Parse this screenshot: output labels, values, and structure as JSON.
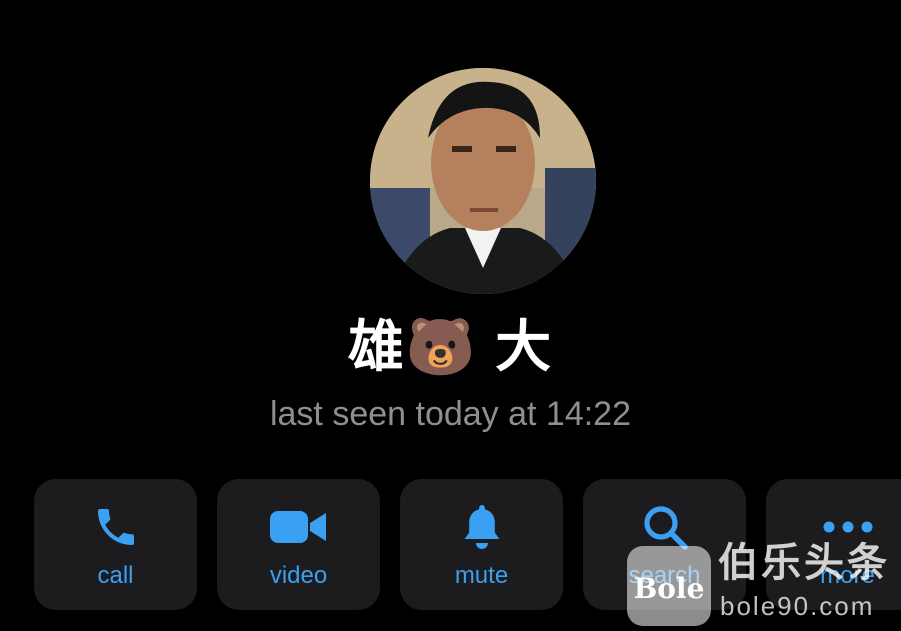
{
  "profile": {
    "name": "雄🐻 大",
    "status": "last seen today at 14:22"
  },
  "actions": [
    {
      "label": "call",
      "icon": "phone-icon"
    },
    {
      "label": "video",
      "icon": "video-camera-icon"
    },
    {
      "label": "mute",
      "icon": "bell-icon"
    },
    {
      "label": "search",
      "icon": "magnifier-icon"
    },
    {
      "label": "more",
      "icon": "ellipsis-icon"
    }
  ],
  "watermark": {
    "logo_text": "Bole",
    "cn_text": "伯乐头条",
    "url": "bole90.com"
  },
  "colors": {
    "background": "#000000",
    "button_bg": "#1c1c1e",
    "accent": "#3aa0f2",
    "status_text": "#8e8e93"
  }
}
